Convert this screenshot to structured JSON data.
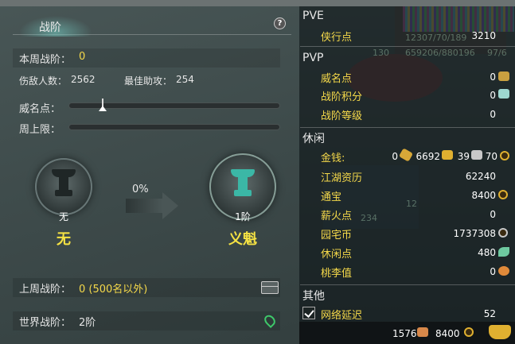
{
  "left_panel": {
    "title": "战阶",
    "help_label": "?",
    "weekly_rank_label": "本周战阶：",
    "weekly_rank_value": "0",
    "kills_label": "伤敌人数：",
    "kills_value": "2562",
    "assist_label": "最佳助攻：",
    "assist_value": "254",
    "prestige_label": "威名点：",
    "prestige_progress": 0.16,
    "weekly_cap_label": "周上限：",
    "weekly_cap_progress": 0,
    "current_medal_rank": "无",
    "current_medal_name": "无",
    "progress_percent": "0%",
    "next_medal_rank": "1阶",
    "next_medal_name": "义魁",
    "last_week_label": "上周战阶：",
    "last_week_value": "0 (500名以外)",
    "world_rank_label": "世界战阶：",
    "world_rank_value": "2阶"
  },
  "right_panel": {
    "pve_title": "PVE",
    "xiaxing_label": "侠行点",
    "xiaxing_value": "3210",
    "pvp_title": "PVP",
    "weiming_label": "威名点",
    "weiming_value": "0",
    "zhanjie_score_label": "战阶积分",
    "zhanjie_score_value": "0",
    "zhanjie_level_label": "战阶等级",
    "zhanjie_level_value": "0",
    "leisure_title": "休闲",
    "money_label": "金钱:",
    "money_value_1": "0",
    "money_value_2": "6692",
    "money_value_3": "39",
    "money_value_4": "70",
    "jianghu_label": "江湖资历",
    "jianghu_value": "62240",
    "tongbao_label": "通宝",
    "tongbao_value": "8400",
    "xinhuo_label": "薪火点",
    "xinhuo_value": "0",
    "yuanzhai_label": "园宅币",
    "yuanzhai_value": "1737308",
    "xiuxian_label": "休闲点",
    "xiuxian_value": "480",
    "taoli_label": "桃李值",
    "taoli_value": "0",
    "other_title": "其他",
    "network_label": "网络延迟",
    "network_value": "52",
    "ghost_line_1": "12307/70/189",
    "ghost_line_2": "659206/880196",
    "ghost_line_3": "97/6",
    "ghost_badge": "130",
    "ghost_num_1": "234",
    "ghost_num_2": "12"
  },
  "footer": {
    "value_1": "1576",
    "value_2": "8400"
  },
  "colors": {
    "yellow_label": "#f5d94a",
    "medal_teal": "#3bb7a6",
    "pin_green": "#3ec96a"
  }
}
